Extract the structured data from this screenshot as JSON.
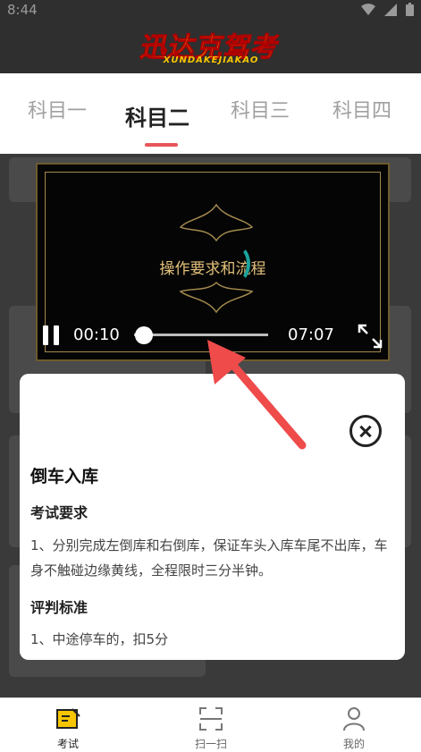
{
  "status_bar": {
    "time": "8:44"
  },
  "header": {
    "logo_text": "迅达克驾考",
    "logo_subtext": "XUNDAKEJIAKAO"
  },
  "tabs": [
    {
      "label": "科目一",
      "active": false
    },
    {
      "label": "科目二",
      "active": true
    },
    {
      "label": "科目三",
      "active": false
    },
    {
      "label": "科目四",
      "active": false
    }
  ],
  "accent_color": "#e8565a",
  "player": {
    "video_title": "操作要求和流程",
    "current_time": "00:10",
    "duration": "07:07",
    "progress": 0.02
  },
  "popup": {
    "title": "倒车入库",
    "section1_heading": "考试要求",
    "section1_text": "1、分别完成左倒库和右倒库，保证车头入库车尾不出库，车身不触碰边缘黄线，全程限时三分半钟。",
    "section2_heading": "评判标准",
    "section2_text": "1、中途停车的，扣5分"
  },
  "bottom_nav": [
    {
      "label": "考试",
      "icon": "exam-icon",
      "active": true
    },
    {
      "label": "扫一扫",
      "icon": "scan-icon",
      "active": false
    },
    {
      "label": "我的",
      "icon": "profile-icon",
      "active": false
    }
  ]
}
